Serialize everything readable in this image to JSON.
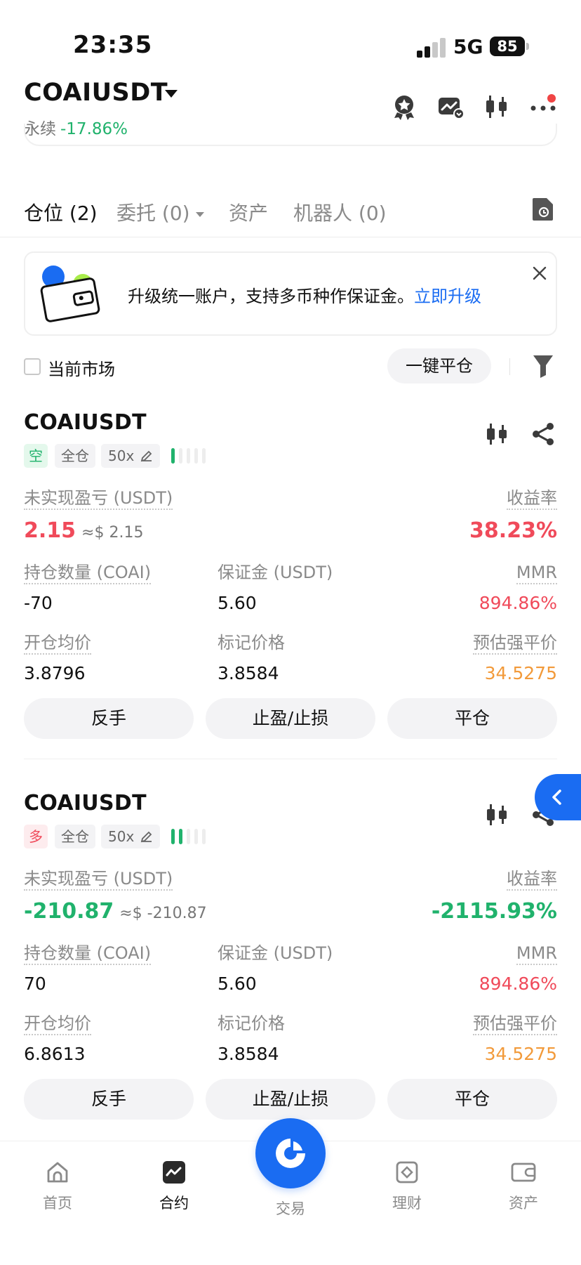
{
  "status_bar": {
    "time": "23:35",
    "network": "5G",
    "battery": "85"
  },
  "header": {
    "pair": "COAIUSDT",
    "contract_type": "永续",
    "change_pct": "-17.86%",
    "icons": [
      "badge-icon",
      "chart-alert-icon",
      "candlestick-icon",
      "more-icon"
    ]
  },
  "tabs": [
    {
      "label": "仓位 (2)",
      "active": true
    },
    {
      "label": "委托 (0)",
      "active": false
    },
    {
      "label": "资产",
      "active": false
    },
    {
      "label": "机器人 (0)",
      "active": false
    }
  ],
  "banner": {
    "text": "升级统一账户，支持多币种作保证金。",
    "link": "立即升级"
  },
  "filter": {
    "checkbox_label": "当前市场",
    "close_all_label": "一键平仓"
  },
  "positions": [
    {
      "symbol": "COAIUSDT",
      "side": "空",
      "margin_mode": "全仓",
      "leverage": "50x",
      "adl_level": 1,
      "pnl_label": "未实现盈亏 (USDT)",
      "pnl": "2.15",
      "pnl_usd": "≈$ 2.15",
      "roe_label": "收益率",
      "roe": "38.23%",
      "qty_label": "持仓数量 (COAI)",
      "qty": "-70",
      "margin_label": "保证金 (USDT)",
      "margin": "5.60",
      "mmr_label": "MMR",
      "mmr": "894.86%",
      "entry_label": "开仓均价",
      "entry": "3.8796",
      "mark_label": "标记价格",
      "mark": "3.8584",
      "liq_label": "预估强平价",
      "liq": "34.5275",
      "buttons": [
        "反手",
        "止盈/止损",
        "平仓"
      ]
    },
    {
      "symbol": "COAIUSDT",
      "side": "多",
      "margin_mode": "全仓",
      "leverage": "50x",
      "adl_level": 2,
      "pnl_label": "未实现盈亏 (USDT)",
      "pnl": "-210.87",
      "pnl_usd": "≈$ -210.87",
      "roe_label": "收益率",
      "roe": "-2115.93%",
      "qty_label": "持仓数量 (COAI)",
      "qty": "70",
      "margin_label": "保证金 (USDT)",
      "margin": "5.60",
      "mmr_label": "MMR",
      "mmr": "894.86%",
      "entry_label": "开仓均价",
      "entry": "6.8613",
      "mark_label": "标记价格",
      "mark": "3.8584",
      "liq_label": "预估强平价",
      "liq": "34.5275",
      "buttons": [
        "反手",
        "止盈/止损",
        "平仓"
      ]
    }
  ],
  "bottom_nav": [
    {
      "label": "首页",
      "icon": "home-icon",
      "active": false
    },
    {
      "label": "合约",
      "icon": "futures-icon",
      "active": true
    },
    {
      "label": "交易",
      "icon": "trade-icon",
      "active": false
    },
    {
      "label": "理财",
      "icon": "earn-icon",
      "active": false
    },
    {
      "label": "资产",
      "icon": "wallet-icon",
      "active": false
    }
  ],
  "colors": {
    "accent": "#1a6cf2",
    "profit": "#20b26c",
    "loss": "#f04a5a",
    "warning": "#f29a3a"
  }
}
